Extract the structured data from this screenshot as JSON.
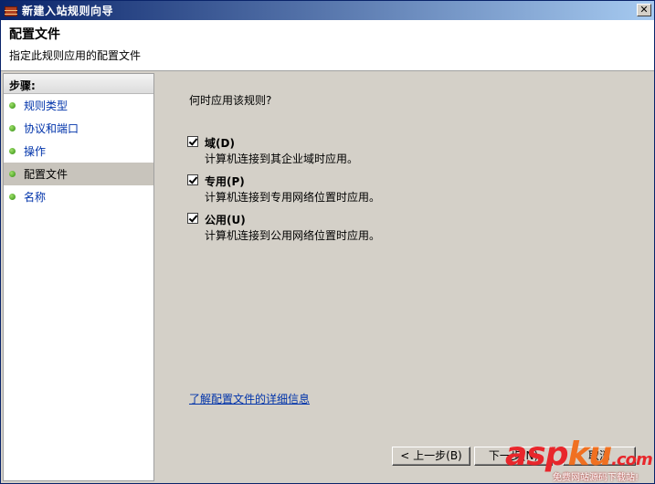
{
  "window": {
    "title": "新建入站规则向导",
    "close_glyph": "✕"
  },
  "header": {
    "title": "配置文件",
    "subtitle": "指定此规则应用的配置文件"
  },
  "sidebar": {
    "heading": "步骤:",
    "items": [
      {
        "label": "规则类型"
      },
      {
        "label": "协议和端口"
      },
      {
        "label": "操作"
      },
      {
        "label": "配置文件"
      },
      {
        "label": "名称"
      }
    ],
    "active_index": 3
  },
  "main": {
    "question": "何时应用该规则?",
    "options": [
      {
        "label": "域(D)",
        "description": "计算机连接到其企业域时应用。",
        "checked": true
      },
      {
        "label": "专用(P)",
        "description": "计算机连接到专用网络位置时应用。",
        "checked": true
      },
      {
        "label": "公用(U)",
        "description": "计算机连接到公用网络位置时应用。",
        "checked": true
      }
    ],
    "learn_more": "了解配置文件的详细信息"
  },
  "buttons": {
    "back": "< 上一步(B)",
    "next": "下一步(N)",
    "cancel": "取消"
  },
  "watermark": {
    "logo_asp": "asp",
    "logo_ku": "ku",
    "logo_net": ".com",
    "tagline": "免费网站源码下载站!"
  },
  "colors": {
    "titlebar_start": "#0a246a",
    "titlebar_end": "#a6caf0",
    "link": "#0033aa",
    "face": "#d4d0c8",
    "step_dot": "#2e8b0e"
  }
}
